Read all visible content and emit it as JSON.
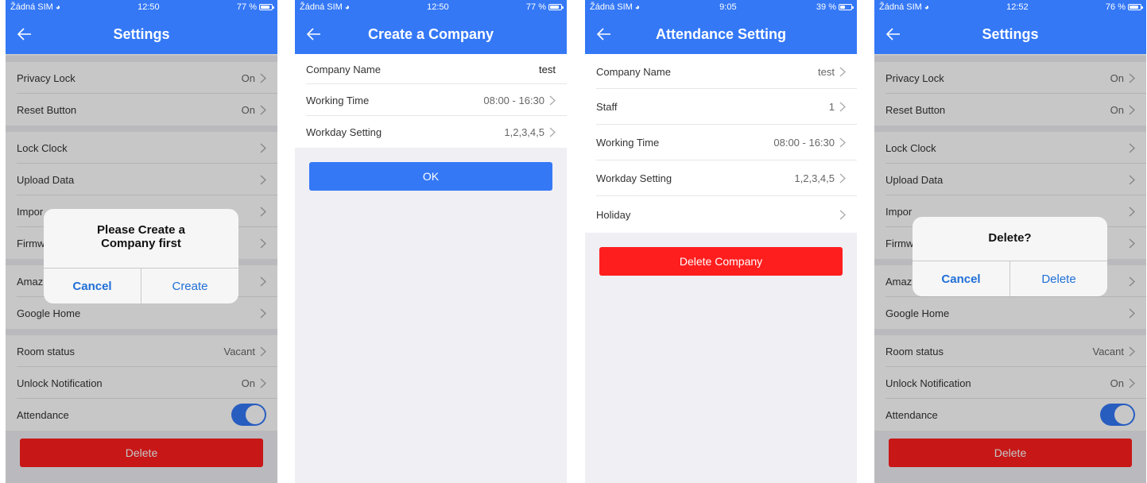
{
  "colors": {
    "nav_blue": "#3478f6",
    "danger_red": "#ff1e1e",
    "dark_red": "#d81e06",
    "link_blue": "#1f6fd6"
  },
  "screens": [
    {
      "status": {
        "carrier": "Žádná SIM",
        "time": "12:50",
        "battery": "77 %",
        "battery_level": 0.77
      },
      "title": "Settings",
      "rows_a": [
        {
          "label": "Privacy Lock",
          "value": "On"
        },
        {
          "label": "Reset Button",
          "value": "On"
        }
      ],
      "rows_b": [
        {
          "label": "Lock Clock",
          "value": ""
        },
        {
          "label": "Upload Data",
          "value": ""
        },
        {
          "label": "Impor",
          "value": ""
        },
        {
          "label": "Firmw",
          "value": ""
        }
      ],
      "rows_c": [
        {
          "label": "Amaz",
          "value": ""
        },
        {
          "label": "Google Home",
          "value": ""
        }
      ],
      "rows_d": [
        {
          "label": "Room status",
          "value": "Vacant"
        },
        {
          "label": "Unlock Notification",
          "value": "On"
        },
        {
          "label": "Attendance",
          "value": ""
        }
      ],
      "attendance_on": true,
      "delete_label": "Delete",
      "alert": {
        "message": "Please Create a Company first",
        "cancel": "Cancel",
        "confirm": "Create"
      }
    },
    {
      "status": {
        "carrier": "Žádná SIM",
        "time": "12:50",
        "battery": "77 %",
        "battery_level": 0.77
      },
      "title": "Create a Company",
      "rows": [
        {
          "label": "Company Name",
          "value": "test"
        },
        {
          "label": "Working Time",
          "value": "08:00 - 16:30"
        },
        {
          "label": "Workday Setting",
          "value": "1,2,3,4,5"
        }
      ],
      "ok_label": "OK"
    },
    {
      "status": {
        "carrier": "Žádná SIM",
        "time": "9:05",
        "battery": "39 %",
        "battery_level": 0.39
      },
      "title": "Attendance Setting",
      "rows": [
        {
          "label": "Company Name",
          "value": "test"
        },
        {
          "label": "Staff",
          "value": "1"
        },
        {
          "label": "Working Time",
          "value": "08:00 - 16:30"
        },
        {
          "label": "Workday Setting",
          "value": "1,2,3,4,5"
        },
        {
          "label": "Holiday",
          "value": ""
        }
      ],
      "delete_company_label": "Delete Company"
    },
    {
      "status": {
        "carrier": "Žádná SIM",
        "time": "12:52",
        "battery": "76 %",
        "battery_level": 0.76
      },
      "title": "Settings",
      "rows_a": [
        {
          "label": "Privacy Lock",
          "value": "On"
        },
        {
          "label": "Reset Button",
          "value": "On"
        }
      ],
      "rows_b": [
        {
          "label": "Lock Clock",
          "value": ""
        },
        {
          "label": "Upload Data",
          "value": ""
        },
        {
          "label": "Impor",
          "value": ""
        },
        {
          "label": "Firmw",
          "value": ""
        }
      ],
      "rows_c": [
        {
          "label": "Amaz",
          "value": ""
        },
        {
          "label": "Google Home",
          "value": ""
        }
      ],
      "rows_d": [
        {
          "label": "Room status",
          "value": "Vacant"
        },
        {
          "label": "Unlock Notification",
          "value": "On"
        },
        {
          "label": "Attendance",
          "value": ""
        }
      ],
      "attendance_on": true,
      "delete_label": "Delete",
      "alert": {
        "message": "Delete?",
        "cancel": "Cancel",
        "confirm": "Delete"
      }
    }
  ]
}
